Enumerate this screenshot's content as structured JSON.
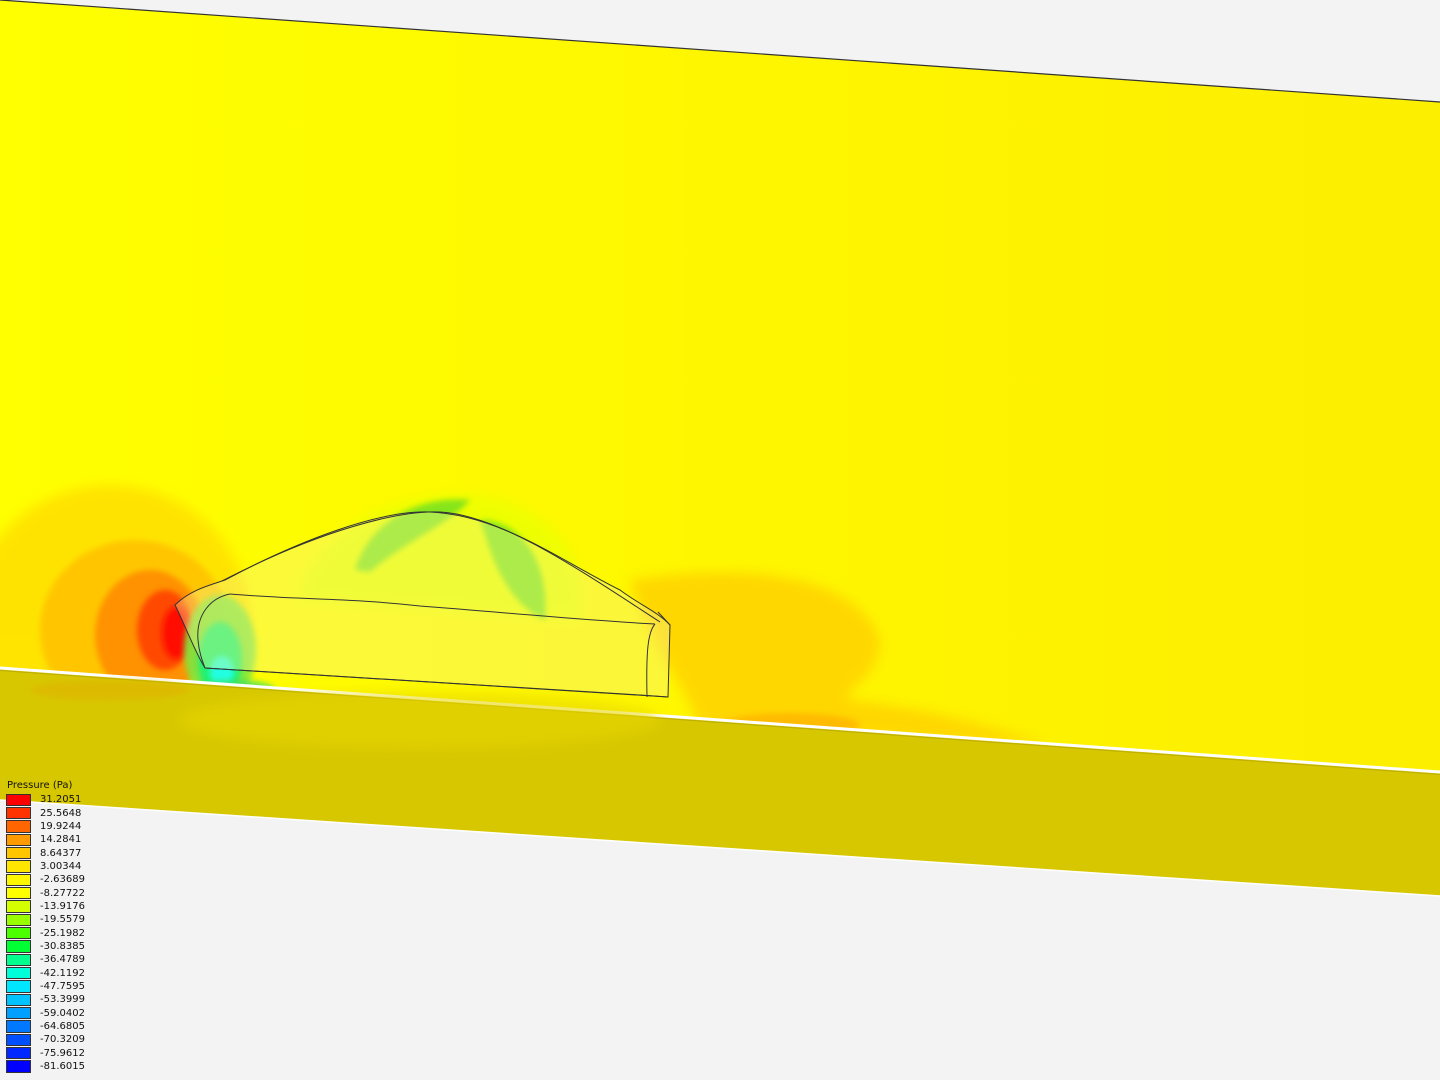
{
  "legend": {
    "title": "Pressure (Pa)",
    "entries": [
      {
        "label": "31.2051",
        "color": "#ff0000"
      },
      {
        "label": "25.5648",
        "color": "#ff3300"
      },
      {
        "label": "19.9244",
        "color": "#ff6600"
      },
      {
        "label": "14.2841",
        "color": "#ff9a00"
      },
      {
        "label": "8.64377",
        "color": "#ffc600"
      },
      {
        "label": "3.00344",
        "color": "#ffe600"
      },
      {
        "label": "-2.63689",
        "color": "#fff700"
      },
      {
        "label": "-8.27722",
        "color": "#ffff00"
      },
      {
        "label": "-13.9176",
        "color": "#d4ff00"
      },
      {
        "label": "-19.5579",
        "color": "#99ff00"
      },
      {
        "label": "-25.1982",
        "color": "#4cff00"
      },
      {
        "label": "-30.8385",
        "color": "#00ff33"
      },
      {
        "label": "-36.4789",
        "color": "#00ff8c"
      },
      {
        "label": "-42.1192",
        "color": "#00ffd9"
      },
      {
        "label": "-47.7595",
        "color": "#00e6ff"
      },
      {
        "label": "-53.3999",
        "color": "#00c3ff"
      },
      {
        "label": "-59.0402",
        "color": "#00a0ff"
      },
      {
        "label": "-64.6805",
        "color": "#0078ff"
      },
      {
        "label": "-70.3209",
        "color": "#0050ff"
      },
      {
        "label": "-75.9612",
        "color": "#0028ff"
      },
      {
        "label": "-81.6015",
        "color": "#0000ff"
      }
    ]
  },
  "colors": {
    "domain_field": "#ffff00",
    "ground_plane": "#d6c600",
    "background": "#f3f3f3",
    "outline": "#333333"
  }
}
